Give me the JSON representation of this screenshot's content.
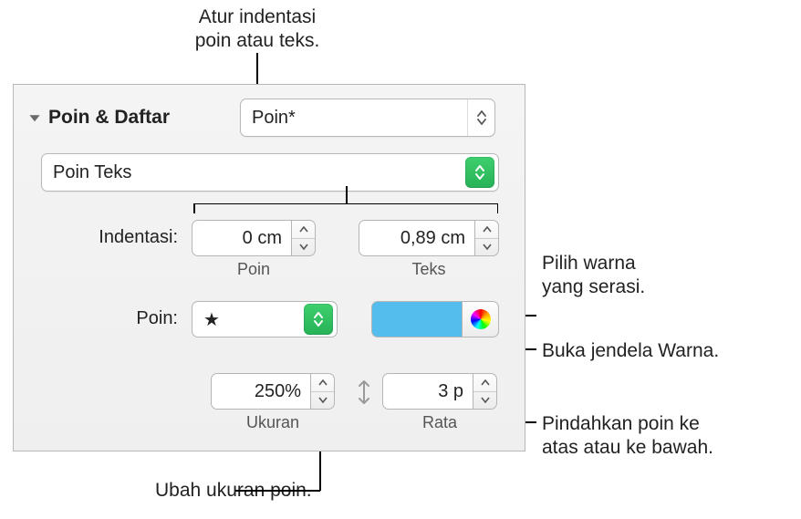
{
  "callouts": {
    "indent": "Atur indentasi",
    "indent2": "poin atau teks.",
    "color1": "Pilih warna",
    "color2": "yang serasi.",
    "colorWindow": "Buka jendela Warna.",
    "move1": "Pindahkan poin ke",
    "move2": "atas atau ke bawah.",
    "size": "Ubah ukuran poin."
  },
  "section": {
    "title": "Poin & Daftar"
  },
  "styleMenu": {
    "value": "Poin*"
  },
  "typeMenu": {
    "value": "Poin Teks"
  },
  "labels": {
    "indent": "Indentasi:",
    "bulletIndentSub": "Poin",
    "textIndentSub": "Teks",
    "bullet": "Poin:",
    "sizeSub": "Ukuran",
    "alignSub": "Rata"
  },
  "values": {
    "bulletIndent": "0 cm",
    "textIndent": "0,89 cm",
    "bulletChar": "★",
    "size": "250%",
    "align": "3 p"
  },
  "colors": {
    "swatch": "#55bdee"
  }
}
